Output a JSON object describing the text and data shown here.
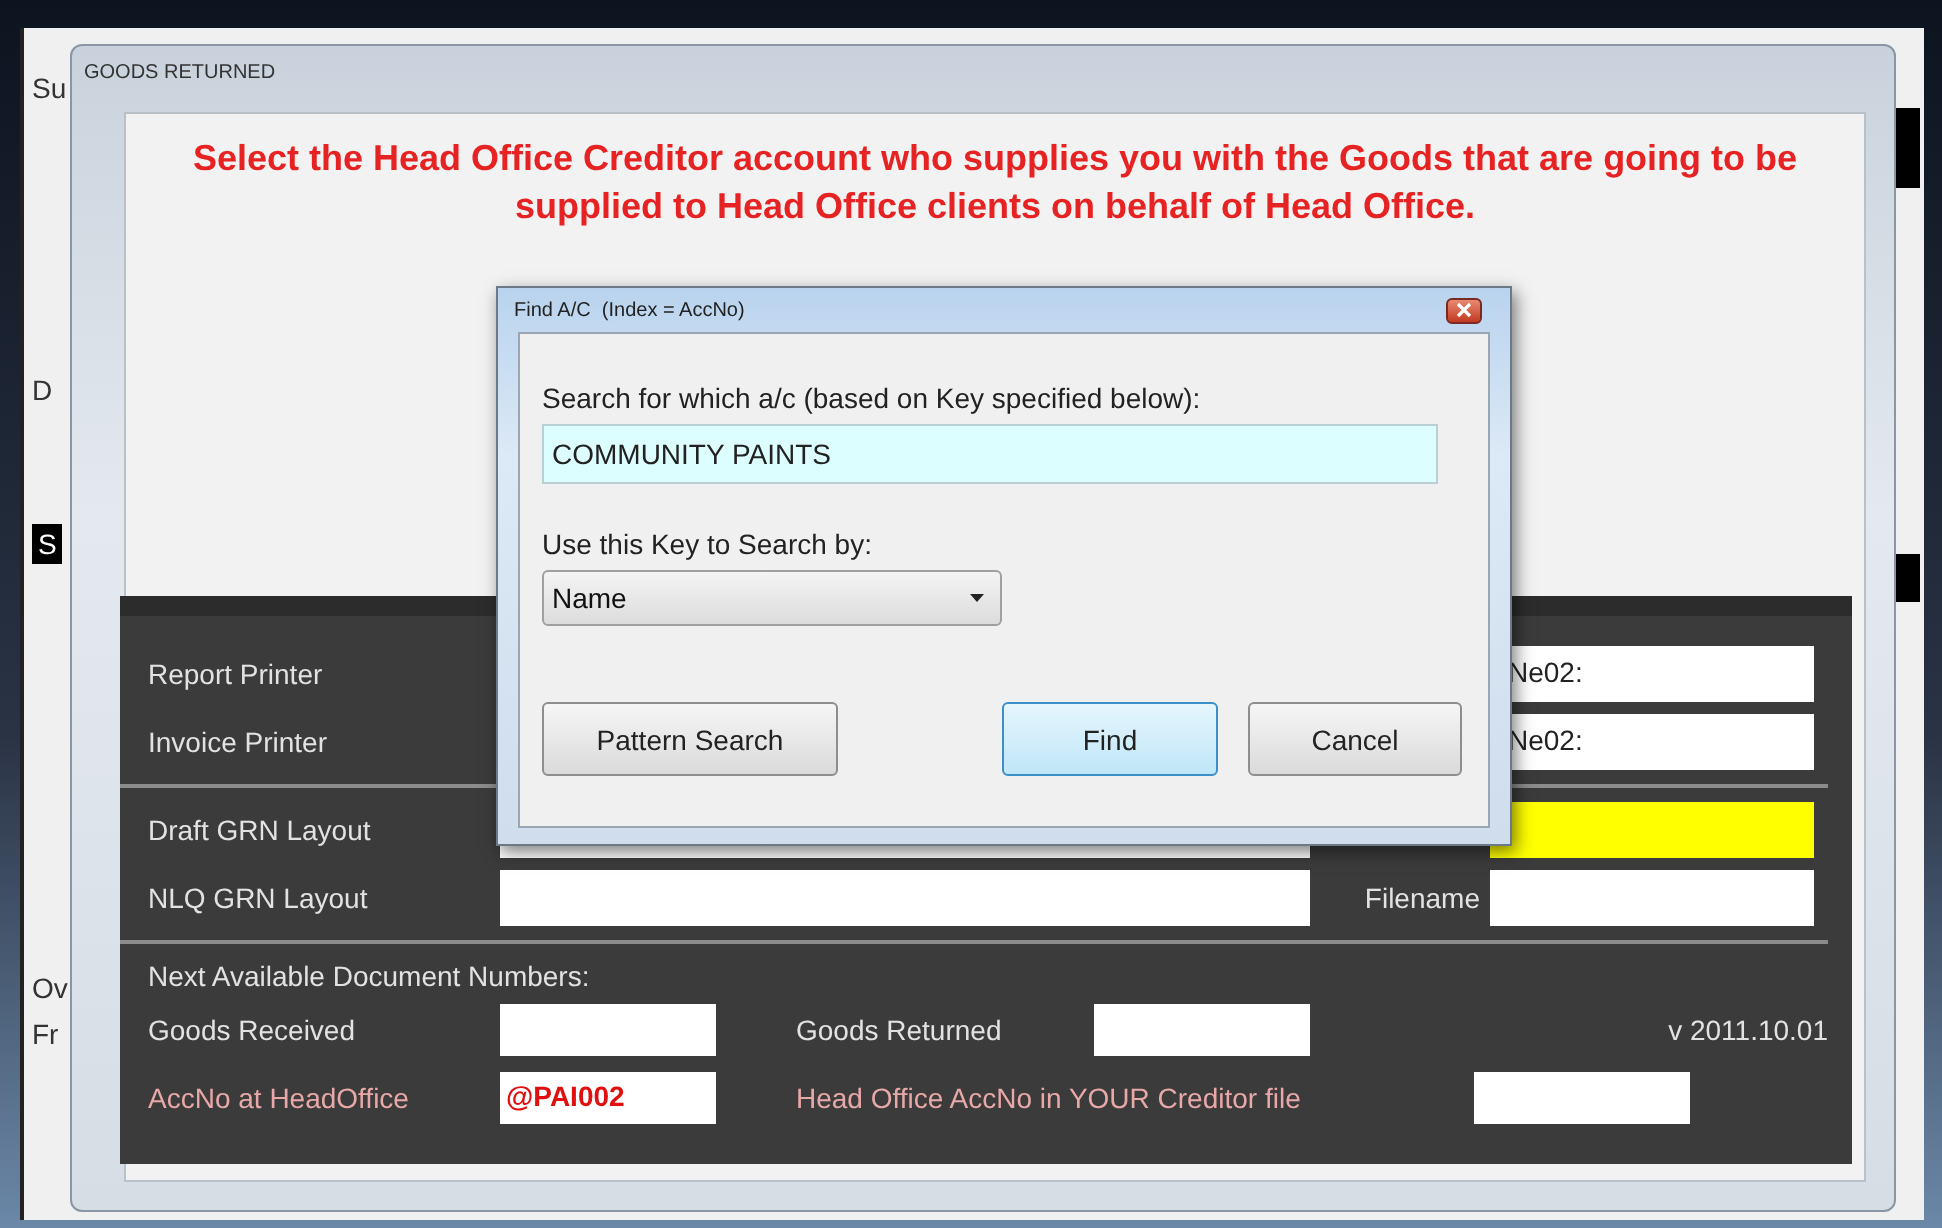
{
  "back_window": {
    "labels": [
      {
        "text": "Su",
        "kind": "plain"
      },
      {
        "text": "D",
        "kind": "plain"
      },
      {
        "text": "S",
        "kind": "highlighted"
      },
      {
        "text": "Ov",
        "kind": "plain"
      },
      {
        "text": "Fr",
        "kind": "plain"
      }
    ]
  },
  "goods_returned_window": {
    "title": "GOODS RETURNED",
    "instruction": "Select the Head Office Creditor account who supplies you with the Goods that are going to be supplied to Head Office clients on behalf of Head Office."
  },
  "settings_panel": {
    "printers": [
      {
        "label": "Report Printer",
        "value": "Ne02:"
      },
      {
        "label": "Invoice Printer",
        "value": "Ne02:"
      }
    ],
    "layouts": [
      {
        "label": "Draft GRN Layout",
        "highlighted": true
      },
      {
        "label": "NLQ GRN Layout",
        "filename_label": "Filename",
        "highlighted": false
      }
    ],
    "document_numbers": {
      "heading": "Next Available Document Numbers:",
      "goods_received_label": "Goods Received",
      "goods_returned_label": "Goods Returned",
      "version": "v 2011.10.01",
      "head_office_accno_label": "AccNo at HeadOffice",
      "head_office_accno_value": "@PAI002",
      "creditor_accno_label": "Head Office AccNo in YOUR Creditor file"
    }
  },
  "find_dialog": {
    "title": "Find A/C  (Index = AccNo)",
    "search_label": "Search for which a/c (based on Key specified below):",
    "search_value": "COMMUNITY PAINTS",
    "key_label": "Use this Key to Search by:",
    "key_value": "Name",
    "buttons": [
      {
        "label": "Pattern Search",
        "default": false
      },
      {
        "label": "Find",
        "default": true
      },
      {
        "label": "Cancel",
        "default": false
      }
    ]
  }
}
